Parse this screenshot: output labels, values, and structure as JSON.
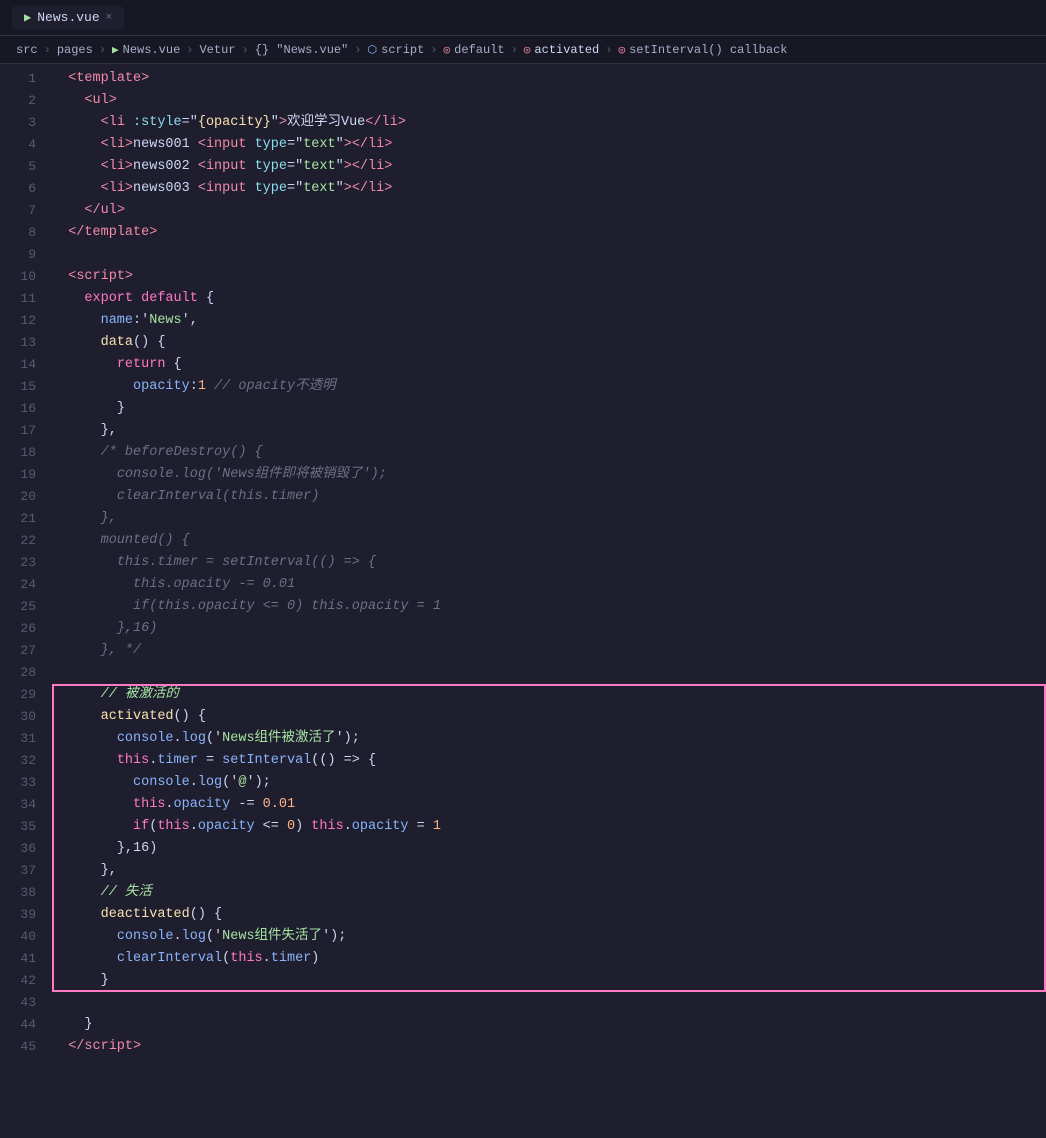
{
  "titleBar": {
    "tab": "News.vue",
    "closeLabel": "×"
  },
  "breadcrumb": {
    "items": [
      "src",
      "pages",
      "News.vue",
      "Vetur",
      "{} \"News.vue\"",
      "script",
      "default",
      "activated",
      "setInterval() callback"
    ]
  },
  "lines": [
    {
      "num": 1,
      "tokens": [
        {
          "t": "  ",
          "c": ""
        },
        {
          "t": "<",
          "c": "tag"
        },
        {
          "t": "template",
          "c": "tag"
        },
        {
          "t": ">",
          "c": "tag"
        }
      ]
    },
    {
      "num": 2,
      "tokens": [
        {
          "t": "    ",
          "c": ""
        },
        {
          "t": "<",
          "c": "tag"
        },
        {
          "t": "ul",
          "c": "tag"
        },
        {
          "t": ">",
          "c": "tag"
        }
      ]
    },
    {
      "num": 3,
      "tokens": [
        {
          "t": "      ",
          "c": ""
        },
        {
          "t": "<",
          "c": "tag"
        },
        {
          "t": "li",
          "c": "tag"
        },
        {
          "t": " ",
          "c": ""
        },
        {
          "t": ":style",
          "c": "attr"
        },
        {
          "t": "=\"",
          "c": "white"
        },
        {
          "t": "{opacity}",
          "c": "yellow"
        },
        {
          "t": "\"",
          "c": "white"
        },
        {
          "t": ">",
          "c": "tag"
        },
        {
          "t": "欢迎学习Vue",
          "c": "white"
        },
        {
          "t": "</",
          "c": "tag"
        },
        {
          "t": "li",
          "c": "tag"
        },
        {
          "t": ">",
          "c": "tag"
        }
      ]
    },
    {
      "num": 4,
      "tokens": [
        {
          "t": "      ",
          "c": ""
        },
        {
          "t": "<",
          "c": "tag"
        },
        {
          "t": "li",
          "c": "tag"
        },
        {
          "t": ">",
          "c": "tag"
        },
        {
          "t": "news001 ",
          "c": "white"
        },
        {
          "t": "<",
          "c": "tag"
        },
        {
          "t": "input",
          "c": "tag"
        },
        {
          "t": " ",
          "c": ""
        },
        {
          "t": "type",
          "c": "attr"
        },
        {
          "t": "=\"",
          "c": "white"
        },
        {
          "t": "text",
          "c": "green"
        },
        {
          "t": "\"",
          "c": "white"
        },
        {
          "t": ">",
          "c": "tag"
        },
        {
          "t": "</",
          "c": "tag"
        },
        {
          "t": "li",
          "c": "tag"
        },
        {
          "t": ">",
          "c": "tag"
        }
      ]
    },
    {
      "num": 5,
      "tokens": [
        {
          "t": "      ",
          "c": ""
        },
        {
          "t": "<",
          "c": "tag"
        },
        {
          "t": "li",
          "c": "tag"
        },
        {
          "t": ">",
          "c": "tag"
        },
        {
          "t": "news002 ",
          "c": "white"
        },
        {
          "t": "<",
          "c": "tag"
        },
        {
          "t": "input",
          "c": "tag"
        },
        {
          "t": " ",
          "c": ""
        },
        {
          "t": "type",
          "c": "attr"
        },
        {
          "t": "=\"",
          "c": "white"
        },
        {
          "t": "text",
          "c": "green"
        },
        {
          "t": "\"",
          "c": "white"
        },
        {
          "t": ">",
          "c": "tag"
        },
        {
          "t": "</",
          "c": "tag"
        },
        {
          "t": "li",
          "c": "tag"
        },
        {
          "t": ">",
          "c": "tag"
        }
      ]
    },
    {
      "num": 6,
      "tokens": [
        {
          "t": "      ",
          "c": ""
        },
        {
          "t": "<",
          "c": "tag"
        },
        {
          "t": "li",
          "c": "tag"
        },
        {
          "t": ">",
          "c": "tag"
        },
        {
          "t": "news003 ",
          "c": "white"
        },
        {
          "t": "<",
          "c": "tag"
        },
        {
          "t": "input",
          "c": "tag"
        },
        {
          "t": " ",
          "c": ""
        },
        {
          "t": "type",
          "c": "attr"
        },
        {
          "t": "=\"",
          "c": "white"
        },
        {
          "t": "text",
          "c": "green"
        },
        {
          "t": "\"",
          "c": "white"
        },
        {
          "t": ">",
          "c": "tag"
        },
        {
          "t": "</",
          "c": "tag"
        },
        {
          "t": "li",
          "c": "tag"
        },
        {
          "t": ">",
          "c": "tag"
        }
      ]
    },
    {
      "num": 7,
      "tokens": [
        {
          "t": "    ",
          "c": ""
        },
        {
          "t": "</",
          "c": "tag"
        },
        {
          "t": "ul",
          "c": "tag"
        },
        {
          "t": ">",
          "c": "tag"
        }
      ]
    },
    {
      "num": 8,
      "tokens": [
        {
          "t": "  ",
          "c": ""
        },
        {
          "t": "</",
          "c": "tag"
        },
        {
          "t": "template",
          "c": "tag"
        },
        {
          "t": ">",
          "c": "tag"
        }
      ]
    },
    {
      "num": 9,
      "tokens": []
    },
    {
      "num": 10,
      "tokens": [
        {
          "t": "  ",
          "c": ""
        },
        {
          "t": "<",
          "c": "tag"
        },
        {
          "t": "script",
          "c": "tag"
        },
        {
          "t": ">",
          "c": "tag"
        }
      ]
    },
    {
      "num": 11,
      "tokens": [
        {
          "t": "    ",
          "c": ""
        },
        {
          "t": "export",
          "c": "kw"
        },
        {
          "t": " ",
          "c": ""
        },
        {
          "t": "default",
          "c": "kw"
        },
        {
          "t": " {",
          "c": "white"
        }
      ]
    },
    {
      "num": 12,
      "tokens": [
        {
          "t": "      ",
          "c": ""
        },
        {
          "t": "name",
          "c": "blue"
        },
        {
          "t": ":'",
          "c": "white"
        },
        {
          "t": "News",
          "c": "green"
        },
        {
          "t": "',",
          "c": "white"
        }
      ]
    },
    {
      "num": 13,
      "tokens": [
        {
          "t": "      ",
          "c": ""
        },
        {
          "t": "data",
          "c": "yellow"
        },
        {
          "t": "() {",
          "c": "white"
        }
      ]
    },
    {
      "num": 14,
      "tokens": [
        {
          "t": "        ",
          "c": ""
        },
        {
          "t": "return",
          "c": "kw"
        },
        {
          "t": " {",
          "c": "white"
        }
      ]
    },
    {
      "num": 15,
      "tokens": [
        {
          "t": "          ",
          "c": ""
        },
        {
          "t": "opacity",
          "c": "blue"
        },
        {
          "t": ":",
          "c": "white"
        },
        {
          "t": "1",
          "c": "num"
        },
        {
          "t": " ",
          "c": ""
        },
        {
          "t": "// opacity不透明",
          "c": "cmt"
        }
      ]
    },
    {
      "num": 16,
      "tokens": [
        {
          "t": "        ",
          "c": ""
        },
        {
          "t": "}",
          "c": "white"
        }
      ]
    },
    {
      "num": 17,
      "tokens": [
        {
          "t": "      ",
          "c": ""
        },
        {
          "t": "},",
          "c": "white"
        }
      ]
    },
    {
      "num": 18,
      "tokens": [
        {
          "t": "      ",
          "c": ""
        },
        {
          "t": "/* beforeDestroy() {",
          "c": "cmt"
        }
      ]
    },
    {
      "num": 19,
      "tokens": [
        {
          "t": "        ",
          "c": ""
        },
        {
          "t": "console",
          "c": "cmt"
        },
        {
          "t": ".",
          "c": "cmt"
        },
        {
          "t": "log",
          "c": "cmt"
        },
        {
          "t": "('News组件即将被销毁了');",
          "c": "cmt"
        }
      ]
    },
    {
      "num": 20,
      "tokens": [
        {
          "t": "        ",
          "c": ""
        },
        {
          "t": "clearInterval",
          "c": "cmt"
        },
        {
          "t": "(",
          "c": "cmt"
        },
        {
          "t": "this",
          "c": "cmt"
        },
        {
          "t": ".",
          "c": "cmt"
        },
        {
          "t": "timer",
          "c": "cmt"
        },
        {
          "t": ")",
          "c": "cmt"
        }
      ]
    },
    {
      "num": 21,
      "tokens": [
        {
          "t": "      ",
          "c": ""
        },
        {
          "t": "},",
          "c": "cmt"
        }
      ]
    },
    {
      "num": 22,
      "tokens": [
        {
          "t": "      ",
          "c": ""
        },
        {
          "t": "mounted",
          "c": "cmt"
        },
        {
          "t": "() {",
          "c": "cmt"
        }
      ]
    },
    {
      "num": 23,
      "tokens": [
        {
          "t": "        ",
          "c": ""
        },
        {
          "t": "this",
          "c": "cmt"
        },
        {
          "t": ".",
          "c": "cmt"
        },
        {
          "t": "timer",
          "c": "cmt"
        },
        {
          "t": " = ",
          "c": "cmt"
        },
        {
          "t": "setInterval",
          "c": "cmt"
        },
        {
          "t": "(() => {",
          "c": "cmt"
        }
      ]
    },
    {
      "num": 24,
      "tokens": [
        {
          "t": "          ",
          "c": ""
        },
        {
          "t": "this",
          "c": "cmt"
        },
        {
          "t": ".",
          "c": "cmt"
        },
        {
          "t": "opacity",
          "c": "cmt"
        },
        {
          "t": " -= ",
          "c": "cmt"
        },
        {
          "t": "0.01",
          "c": "cmt"
        }
      ]
    },
    {
      "num": 25,
      "tokens": [
        {
          "t": "          ",
          "c": ""
        },
        {
          "t": "if",
          "c": "cmt"
        },
        {
          "t": "(",
          "c": "cmt"
        },
        {
          "t": "this",
          "c": "cmt"
        },
        {
          "t": ".",
          "c": "cmt"
        },
        {
          "t": "opacity",
          "c": "cmt"
        },
        {
          "t": " <= ",
          "c": "cmt"
        },
        {
          "t": "0",
          "c": "cmt"
        },
        {
          "t": ") ",
          "c": "cmt"
        },
        {
          "t": "this",
          "c": "cmt"
        },
        {
          "t": ".",
          "c": "cmt"
        },
        {
          "t": "opacity",
          "c": "cmt"
        },
        {
          "t": " = ",
          "c": "cmt"
        },
        {
          "t": "1",
          "c": "cmt"
        }
      ]
    },
    {
      "num": 26,
      "tokens": [
        {
          "t": "        ",
          "c": ""
        },
        {
          "t": "},16)",
          "c": "cmt"
        }
      ]
    },
    {
      "num": 27,
      "tokens": [
        {
          "t": "      ",
          "c": ""
        },
        {
          "t": "}, */",
          "c": "cmt"
        }
      ]
    },
    {
      "num": 28,
      "tokens": []
    },
    {
      "num": 29,
      "tokens": [
        {
          "t": "      ",
          "c": ""
        },
        {
          "t": "// 被激活的",
          "c": "cmt2"
        }
      ],
      "hlStart": true
    },
    {
      "num": 30,
      "tokens": [
        {
          "t": "      ",
          "c": ""
        },
        {
          "t": "activated",
          "c": "yellow"
        },
        {
          "t": "() {",
          "c": "white"
        }
      ],
      "hl": true
    },
    {
      "num": 31,
      "tokens": [
        {
          "t": "        ",
          "c": ""
        },
        {
          "t": "console",
          "c": "blue"
        },
        {
          "t": ".",
          "c": "white"
        },
        {
          "t": "log",
          "c": "blue"
        },
        {
          "t": "('",
          "c": "white"
        },
        {
          "t": "News组件被激活了",
          "c": "green"
        },
        {
          "t": "');",
          "c": "white"
        }
      ],
      "hl": true
    },
    {
      "num": 32,
      "tokens": [
        {
          "t": "        ",
          "c": ""
        },
        {
          "t": "this",
          "c": "kw"
        },
        {
          "t": ".",
          "c": "white"
        },
        {
          "t": "timer",
          "c": "blue"
        },
        {
          "t": " = ",
          "c": "white"
        },
        {
          "t": "setInterval",
          "c": "blue"
        },
        {
          "t": "(() => {",
          "c": "white"
        }
      ],
      "hl": true
    },
    {
      "num": 33,
      "tokens": [
        {
          "t": "          ",
          "c": ""
        },
        {
          "t": "console",
          "c": "blue"
        },
        {
          "t": ".",
          "c": "white"
        },
        {
          "t": "log",
          "c": "blue"
        },
        {
          "t": "('",
          "c": "white"
        },
        {
          "t": "@",
          "c": "green"
        },
        {
          "t": "');",
          "c": "white"
        }
      ],
      "hl": true
    },
    {
      "num": 34,
      "tokens": [
        {
          "t": "          ",
          "c": ""
        },
        {
          "t": "this",
          "c": "kw"
        },
        {
          "t": ".",
          "c": "white"
        },
        {
          "t": "opacity",
          "c": "blue"
        },
        {
          "t": " -= ",
          "c": "white"
        },
        {
          "t": "0.01",
          "c": "num"
        }
      ],
      "hl": true
    },
    {
      "num": 35,
      "tokens": [
        {
          "t": "          ",
          "c": ""
        },
        {
          "t": "if",
          "c": "kw"
        },
        {
          "t": "(",
          "c": "white"
        },
        {
          "t": "this",
          "c": "kw"
        },
        {
          "t": ".",
          "c": "white"
        },
        {
          "t": "opacity",
          "c": "blue"
        },
        {
          "t": " <= ",
          "c": "white"
        },
        {
          "t": "0",
          "c": "num"
        },
        {
          "t": ") ",
          "c": "white"
        },
        {
          "t": "this",
          "c": "kw"
        },
        {
          "t": ".",
          "c": "white"
        },
        {
          "t": "opacity",
          "c": "blue"
        },
        {
          "t": " = ",
          "c": "white"
        },
        {
          "t": "1",
          "c": "num"
        }
      ],
      "hl": true
    },
    {
      "num": 36,
      "tokens": [
        {
          "t": "        ",
          "c": ""
        },
        {
          "t": "},16)",
          "c": "white"
        }
      ],
      "hl": true
    },
    {
      "num": 37,
      "tokens": [
        {
          "t": "      ",
          "c": ""
        },
        {
          "t": "},",
          "c": "white"
        }
      ],
      "hl": true
    },
    {
      "num": 38,
      "tokens": [
        {
          "t": "      ",
          "c": ""
        },
        {
          "t": "// 失活",
          "c": "cmt2"
        }
      ],
      "hl": true
    },
    {
      "num": 39,
      "tokens": [
        {
          "t": "      ",
          "c": ""
        },
        {
          "t": "deactivated",
          "c": "yellow"
        },
        {
          "t": "() {",
          "c": "white"
        }
      ],
      "hl": true
    },
    {
      "num": 40,
      "tokens": [
        {
          "t": "        ",
          "c": ""
        },
        {
          "t": "console",
          "c": "blue"
        },
        {
          "t": ".",
          "c": "white"
        },
        {
          "t": "log",
          "c": "blue"
        },
        {
          "t": "('",
          "c": "white"
        },
        {
          "t": "News组件失活了",
          "c": "green"
        },
        {
          "t": "');",
          "c": "white"
        }
      ],
      "hl": true
    },
    {
      "num": 41,
      "tokens": [
        {
          "t": "        ",
          "c": ""
        },
        {
          "t": "clearInterval",
          "c": "blue"
        },
        {
          "t": "(",
          "c": "white"
        },
        {
          "t": "this",
          "c": "kw"
        },
        {
          "t": ".",
          "c": "white"
        },
        {
          "t": "timer",
          "c": "blue"
        },
        {
          "t": ")",
          "c": "white"
        }
      ],
      "hl": true
    },
    {
      "num": 42,
      "tokens": [
        {
          "t": "      ",
          "c": ""
        },
        {
          "t": "}",
          "c": "white"
        }
      ],
      "hlEnd": true
    },
    {
      "num": 43,
      "tokens": []
    },
    {
      "num": 44,
      "tokens": [
        {
          "t": "    ",
          "c": ""
        },
        {
          "t": "}",
          "c": "white"
        }
      ]
    },
    {
      "num": 45,
      "tokens": [
        {
          "t": "  ",
          "c": ""
        },
        {
          "t": "</",
          "c": "tag"
        },
        {
          "t": "script",
          "c": "tag"
        },
        {
          "t": ">",
          "c": "tag"
        }
      ]
    }
  ]
}
